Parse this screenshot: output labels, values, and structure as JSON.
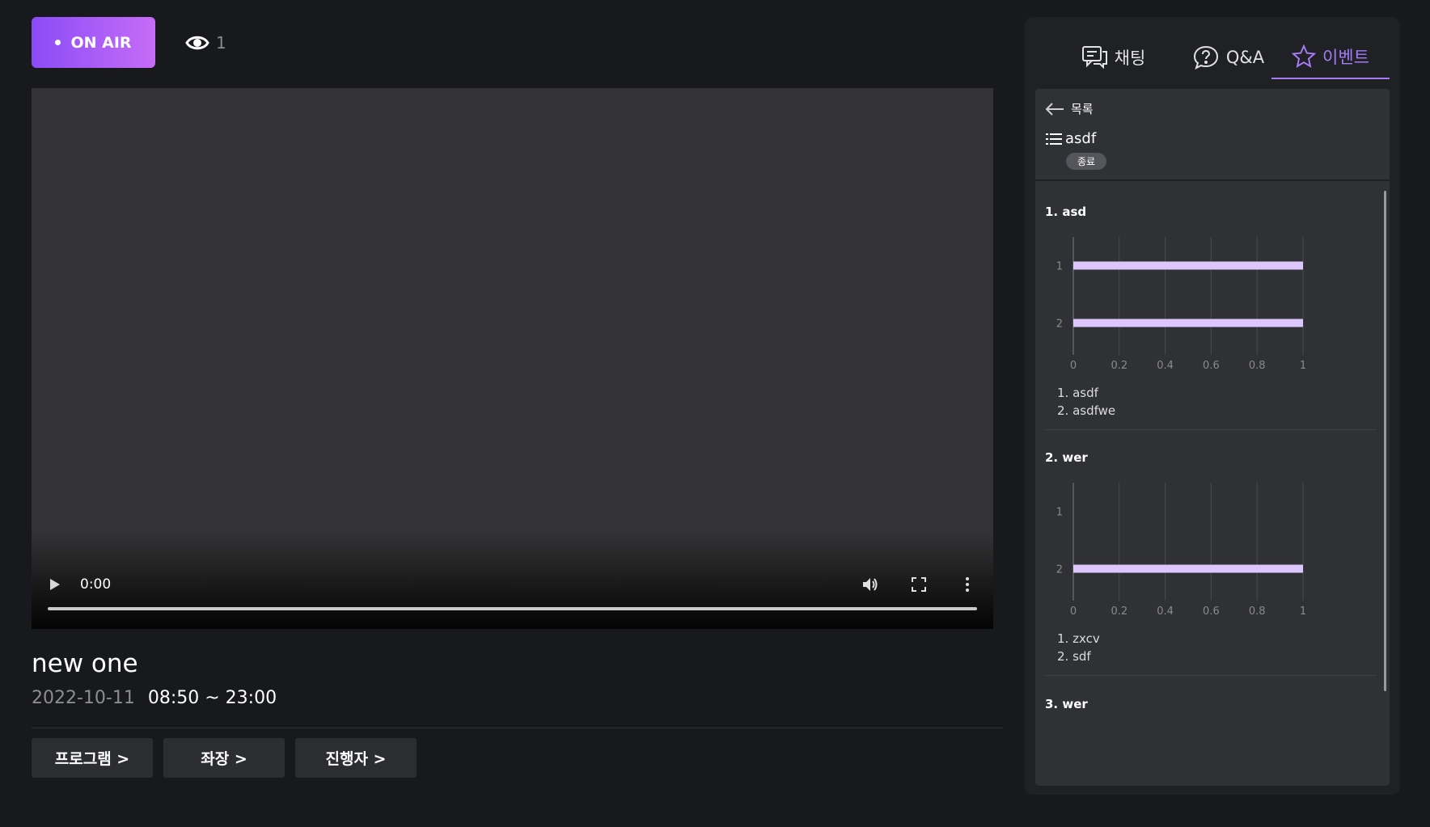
{
  "live": {
    "status_label": "ON AIR",
    "viewer_count": "1"
  },
  "player": {
    "current_time": "0:00",
    "progress": 0
  },
  "program": {
    "title": "new one",
    "date": "2022-10-11",
    "time_range": "08:50 ~ 23:00"
  },
  "nav_buttons": [
    {
      "label": "프로그램 >"
    },
    {
      "label": "좌장 >"
    },
    {
      "label": "진행자 >"
    }
  ],
  "tabs": [
    {
      "label": "채팅",
      "icon": "chat-icon",
      "active": false
    },
    {
      "label": "Q&A",
      "icon": "question-icon",
      "active": false
    },
    {
      "label": "이벤트",
      "icon": "star-icon",
      "active": true
    }
  ],
  "event": {
    "back_label": "목록",
    "name": "asdf",
    "status_badge": "종료",
    "questions": [
      {
        "title": "1. asd",
        "options": [
          "1. asdf",
          "2. asdfwe"
        ]
      },
      {
        "title": "2. wer",
        "options": [
          "1. zxcv",
          "2. sdf"
        ]
      },
      {
        "title": "3. wer",
        "options": []
      }
    ]
  },
  "colors": {
    "accent": "#a57bf6",
    "bar": "#dcc6fb",
    "onair_start": "#8a4cf7",
    "onair_end": "#c66cf7"
  },
  "chart_data": [
    {
      "type": "bar",
      "orientation": "horizontal",
      "categories": [
        "1",
        "2"
      ],
      "values": [
        1,
        1
      ],
      "xlim": [
        0,
        1
      ],
      "xticks": [
        "0",
        "0.2",
        "0.4",
        "0.6",
        "0.8",
        "1"
      ],
      "grid": true
    },
    {
      "type": "bar",
      "orientation": "horizontal",
      "categories": [
        "1",
        "2"
      ],
      "values": [
        0,
        1
      ],
      "xlim": [
        0,
        1
      ],
      "xticks": [
        "0",
        "0.2",
        "0.4",
        "0.6",
        "0.8",
        "1"
      ],
      "grid": true
    }
  ]
}
